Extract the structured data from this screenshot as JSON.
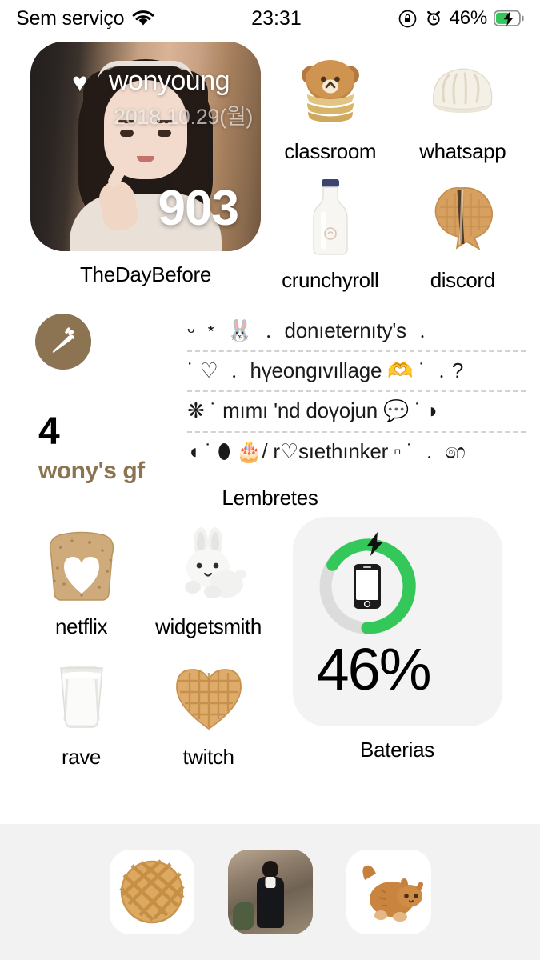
{
  "status_bar": {
    "carrier": "Sem serviço",
    "wifi_icon": "wifi-icon",
    "time": "23:31",
    "rotation_lock_icon": "rotation-lock-icon",
    "alarm_icon": "alarm-clock-icon",
    "battery_percent": "46%",
    "battery_icon": "battery-charging-icon",
    "battery_color": "#34C759"
  },
  "photo_widget": {
    "heart_icon": "heart-icon",
    "name": "wonyoung",
    "date": "2018.10.29(월)",
    "day_count": "903",
    "label": "TheDayBefore"
  },
  "apps_top": [
    {
      "label": "classroom",
      "icon": "bear-pancake-icon",
      "glyph": "🥞"
    },
    {
      "label": "whatsapp",
      "icon": "dumpling-icon",
      "glyph": "🥟"
    },
    {
      "label": "crunchyroll",
      "icon": "milk-bottle-icon",
      "glyph": "🍼"
    },
    {
      "label": "discord",
      "icon": "fish-waffle-icon",
      "glyph": "🥮"
    }
  ],
  "reminders_widget": {
    "list_icon": "carrot-icon",
    "list_icon_color": "#8c7351",
    "count": "4",
    "list_name": "wony's gf",
    "label": "Lembretes",
    "items": [
      "ᵕ ﹡ 🐰 ﹒ donıeternıty's ﹒",
      "˙ ♡ ﹒ hүeongıvıllage 🫶 ˙ ﹒?",
      "❋ ˙ mımı 'nd doүojun 💬 ˙ ◗",
      "◖ ˙ ⬮ 🎂/ r♡sıethınker ▫ ˙ ﹒ ෨"
    ]
  },
  "apps_bottom": [
    {
      "label": "netflix",
      "icon": "heart-bread-icon",
      "glyph": "🍞"
    },
    {
      "label": "widgetsmith",
      "icon": "white-bunny-icon",
      "glyph": "🐇"
    },
    {
      "label": "rave",
      "icon": "milk-glass-icon",
      "glyph": "🥛"
    },
    {
      "label": "twitch",
      "icon": "heart-waffle-icon",
      "glyph": "🧇"
    }
  ],
  "battery_widget": {
    "bolt_icon": "lightning-bolt-icon",
    "phone_icon": "iphone-icon",
    "percent": "46%",
    "percent_value": 46,
    "label": "Baterias",
    "ring_color": "#34C759",
    "track_color": "#dcdcdc"
  },
  "dock": [
    {
      "icon": "waffle-icon",
      "glyph": "🧇",
      "name": "dock-app-waffle"
    },
    {
      "icon": "girl-photo-icon",
      "glyph": "",
      "name": "dock-app-photo"
    },
    {
      "icon": "orange-cat-icon",
      "glyph": "🐈",
      "name": "dock-app-cat"
    }
  ]
}
